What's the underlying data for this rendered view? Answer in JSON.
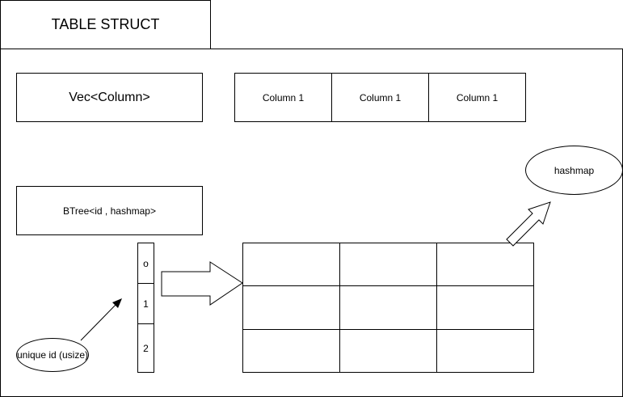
{
  "title": "TABLE STRUCT",
  "vec_label": "Vec<Column>",
  "columns": [
    "Column 1",
    "Column 1",
    "Column 1"
  ],
  "btree_label": "BTree<id , hashmap>",
  "index_cells": [
    "o",
    "1",
    "2"
  ],
  "hashmap_label": "hashmap",
  "unique_id_label": "unique id (usize)",
  "grid": {
    "rows": 3,
    "cols": 3
  }
}
